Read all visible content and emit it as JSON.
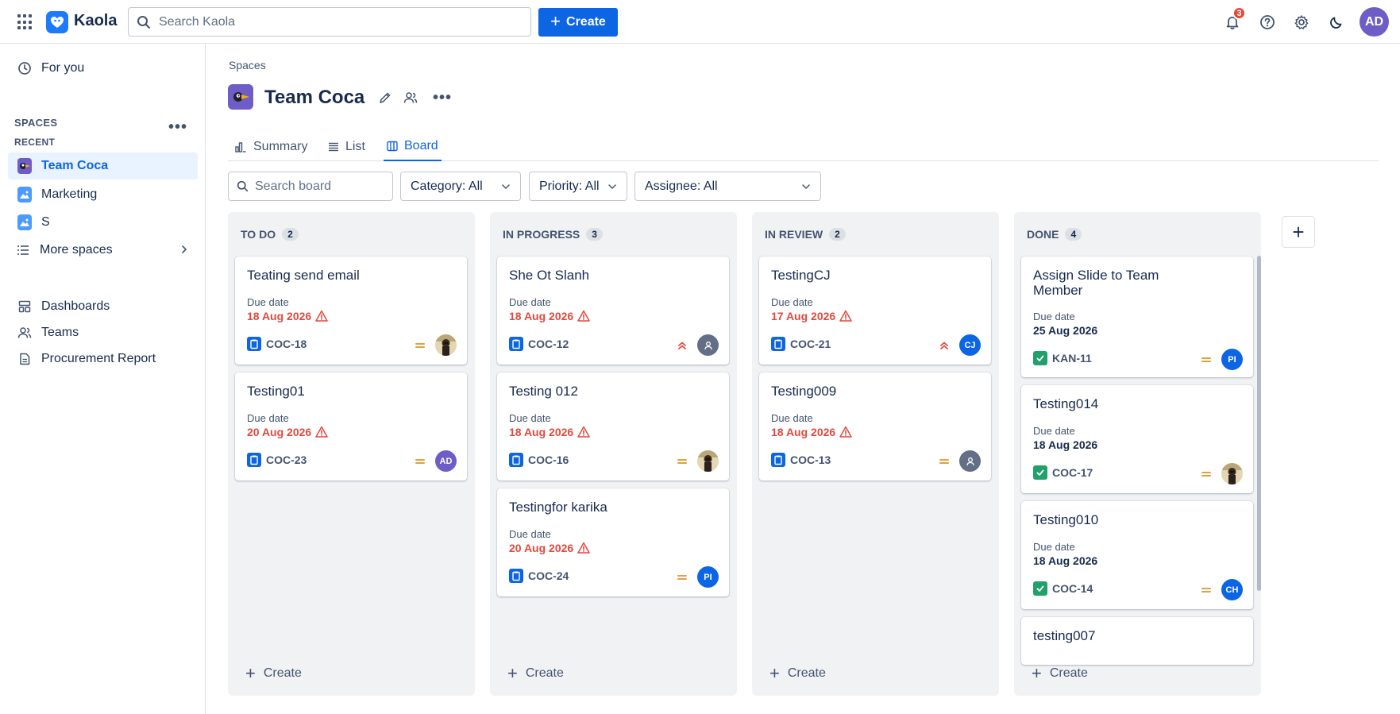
{
  "app": {
    "name": "Kaola"
  },
  "topbar": {
    "search_placeholder": "Search Kaola",
    "create_label": "Create",
    "notification_count": "3",
    "user_initials": "AD",
    "colors": {
      "primary": "#0c66e4",
      "avatar": "#6e5dc6",
      "badge": "#e34935"
    }
  },
  "sidebar": {
    "for_you": "For you",
    "spaces_label": "SPACES",
    "recent_label": "RECENT",
    "spaces": [
      {
        "name": "Team Coca",
        "icon": "toucan-icon"
      },
      {
        "name": "Marketing",
        "icon": "image-icon"
      },
      {
        "name": "S",
        "icon": "image-icon"
      }
    ],
    "more_spaces": "More spaces",
    "links": [
      {
        "label": "Dashboards",
        "icon": "dashboard-icon"
      },
      {
        "label": "Teams",
        "icon": "people-icon"
      },
      {
        "label": "Procurement Report",
        "icon": "document-icon"
      }
    ]
  },
  "main": {
    "breadcrumb": "Spaces",
    "title": "Team Coca",
    "tabs": [
      {
        "label": "Summary",
        "icon": "chart-icon"
      },
      {
        "label": "List",
        "icon": "list-icon"
      },
      {
        "label": "Board",
        "icon": "board-icon",
        "active": true
      }
    ],
    "filters": {
      "search_placeholder": "Search board",
      "category": "Category: All",
      "priority": "Priority: All",
      "assignee": "Assignee: All"
    }
  },
  "board": {
    "create_label": "Create",
    "due_label": "Due date",
    "columns": [
      {
        "name": "TO DO",
        "count": "2",
        "cards": [
          {
            "title": "Teating send email",
            "due": "18 Aug 2026",
            "overdue": true,
            "key": "COC-18",
            "type": "task",
            "priority": "medium",
            "assignee": "photo"
          },
          {
            "title": "Testing01",
            "due": "20 Aug 2026",
            "overdue": true,
            "key": "COC-23",
            "type": "task",
            "priority": "medium",
            "assignee": "AD"
          }
        ]
      },
      {
        "name": "IN PROGRESS",
        "count": "3",
        "cards": [
          {
            "title": "She Ot Slanh",
            "due": "18 Aug 2026",
            "overdue": true,
            "key": "COC-12",
            "type": "task",
            "priority": "high",
            "assignee": "unassigned"
          },
          {
            "title": "Testing 012",
            "due": "18 Aug 2026",
            "overdue": true,
            "key": "COC-16",
            "type": "task",
            "priority": "medium",
            "assignee": "photo"
          },
          {
            "title": "Testingfor karika",
            "due": "20 Aug 2026",
            "overdue": true,
            "key": "COC-24",
            "type": "task",
            "priority": "medium",
            "assignee": "PI"
          }
        ]
      },
      {
        "name": "IN REVIEW",
        "count": "2",
        "cards": [
          {
            "title": "TestingCJ",
            "due": "17 Aug 2026",
            "overdue": true,
            "key": "COC-21",
            "type": "task",
            "priority": "high",
            "assignee": "CJ"
          },
          {
            "title": "Testing009",
            "due": "18 Aug 2026",
            "overdue": true,
            "key": "COC-13",
            "type": "task",
            "priority": "medium",
            "assignee": "unassigned"
          }
        ]
      },
      {
        "name": "DONE",
        "count": "4",
        "cards": [
          {
            "title": "Assign Slide to Team Member",
            "due": "25 Aug 2026",
            "overdue": false,
            "key": "KAN-11",
            "type": "done",
            "priority": "medium",
            "assignee": "PI"
          },
          {
            "title": "Testing014",
            "due": "18 Aug 2026",
            "overdue": false,
            "key": "COC-17",
            "type": "done",
            "priority": "medium",
            "assignee": "photo"
          },
          {
            "title": "Testing010",
            "due": "18 Aug 2026",
            "overdue": false,
            "key": "COC-14",
            "type": "done",
            "priority": "medium",
            "assignee": "CH"
          },
          {
            "title": "testing007"
          }
        ]
      }
    ]
  }
}
